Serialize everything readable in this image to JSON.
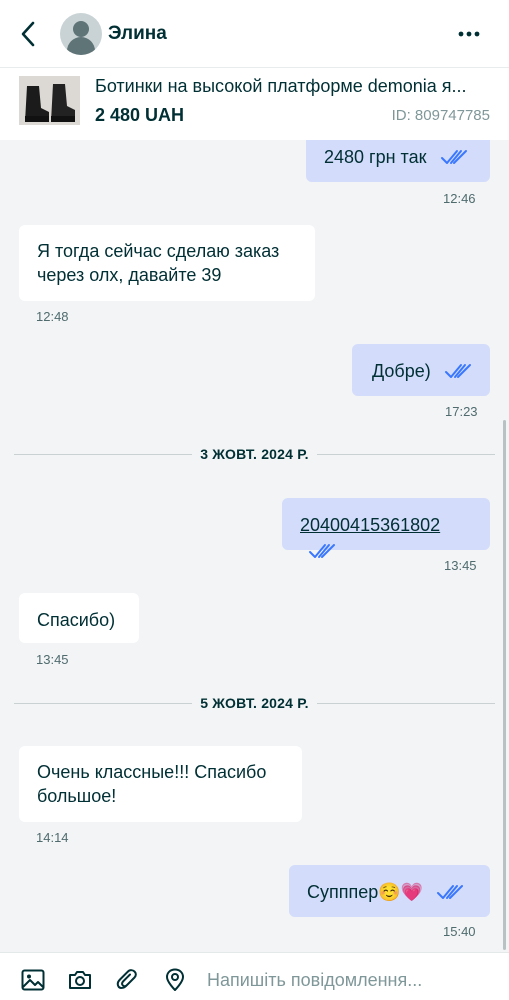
{
  "header": {
    "user_name": "Элина"
  },
  "product": {
    "title": "Ботинки на высокой платформе demonia я...",
    "price": "2 480 UAH",
    "id": "ID: 809747785"
  },
  "messages": [
    {
      "direction": "out",
      "text": "2480 грн так",
      "time": "12:46",
      "status": "read"
    },
    {
      "direction": "in",
      "text_lines": [
        "Я тогда сейчас сделаю заказ",
        "через олх, давайте 39"
      ],
      "time": "12:48"
    },
    {
      "direction": "out",
      "text": "Добре)",
      "time": "17:23",
      "status": "read"
    },
    {
      "date_separator": "3 ЖОВТ. 2024 Р."
    },
    {
      "direction": "out",
      "text": "20400415361802",
      "time": "13:45",
      "status": "read",
      "is_link": true
    },
    {
      "direction": "in",
      "text": "Спасибо)",
      "time": "13:45"
    },
    {
      "date_separator": "5 ЖОВТ. 2024 Р."
    },
    {
      "direction": "in",
      "text_lines": [
        "Очень классные!!! Спасибо",
        "большое!"
      ],
      "time": "14:14"
    },
    {
      "direction": "out",
      "text": "Супппер☺️💗",
      "time": "15:40",
      "status": "read"
    }
  ],
  "composer": {
    "placeholder": "Напишіть повідомлення..."
  },
  "icons": {
    "back": "chevron-left-icon",
    "more": "more-horizontal-icon",
    "read_status": "double-check-icon",
    "image": "image-icon",
    "camera": "camera-icon",
    "attach": "paperclip-icon",
    "location": "location-pin-icon"
  },
  "colors": {
    "outgoing_bubble": "#d3dcfb",
    "incoming_bubble": "#ffffff",
    "background": "#f2f4f5",
    "text": "#002f34",
    "read_ticks": "#3a77ff"
  }
}
